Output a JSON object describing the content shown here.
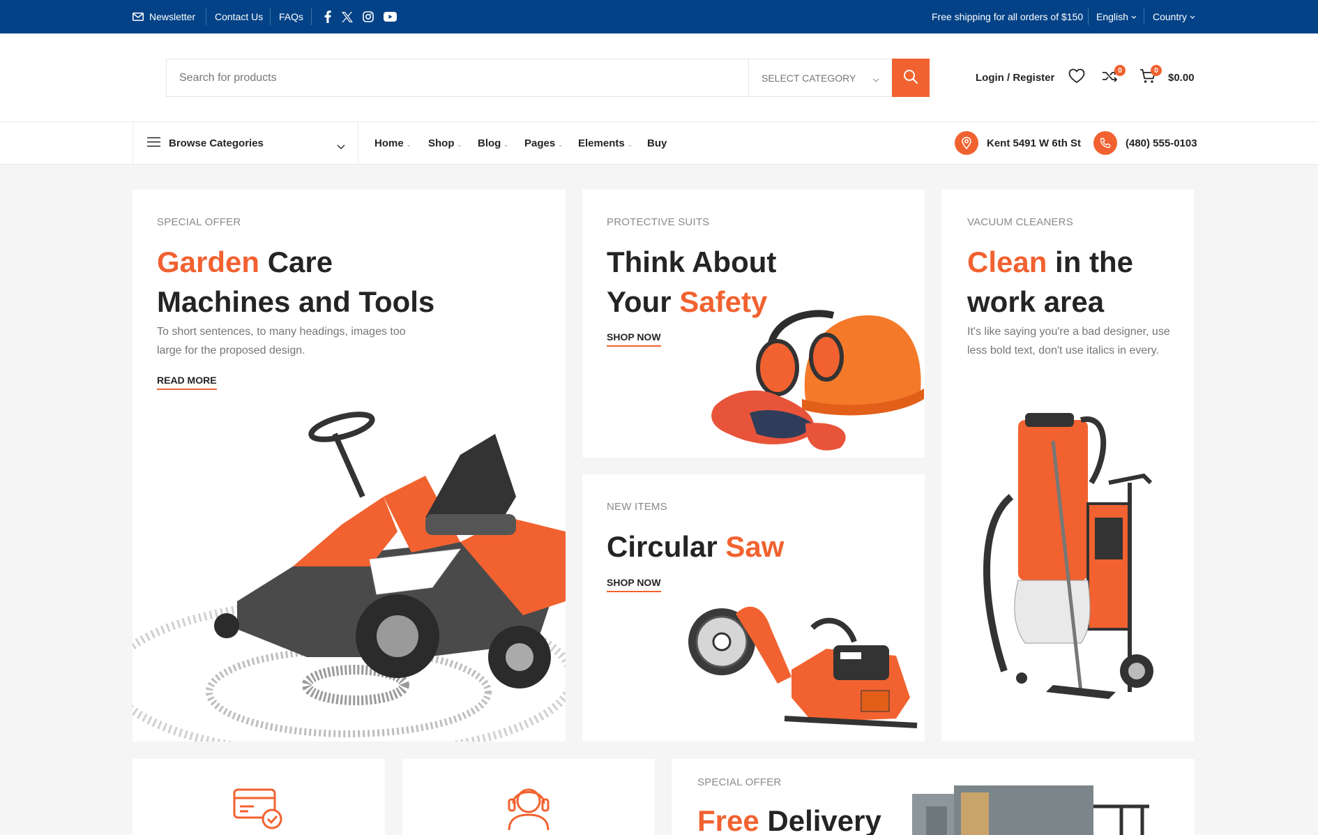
{
  "topbar": {
    "newsletter": "Newsletter",
    "contact_us": "Contact Us",
    "faqs": "FAQs",
    "shipping": "Free shipping for all orders of $150",
    "language": "English",
    "country": "Country",
    "social_icons": [
      "facebook-icon",
      "x-twitter-icon",
      "instagram-icon",
      "youtube-icon"
    ]
  },
  "header": {
    "search_placeholder": "Search for products",
    "category_select": "SELECT CATEGORY",
    "login": "Login / Register",
    "compare_count": "0",
    "cart_count": "0",
    "cart_total": "$0.00"
  },
  "nav": {
    "browse": "Browse Categories",
    "items": [
      "Home",
      "Shop",
      "Blog",
      "Pages",
      "Elements",
      "Buy"
    ],
    "address": "Kent 5491 W 6th St",
    "phone": "(480) 555-0103"
  },
  "cards": {
    "garden": {
      "eyebrow": "SPECIAL OFFER",
      "title_hl": "Garden",
      "title_rest": "Care",
      "title_line2": "Machines and Tools",
      "desc_line1": "To short sentences, to many headings, images too",
      "desc_line2": "large for the proposed design.",
      "cta": "READ MORE"
    },
    "safety": {
      "eyebrow": "PROTECTIVE SUITS",
      "title_line1": "Think About",
      "title_pre": "Your",
      "title_hl": "Safety",
      "cta": "SHOP NOW"
    },
    "vacuum": {
      "eyebrow": "VACUUM CLEANERS",
      "title_hl": "Clean",
      "title_rest": "in the",
      "title_line2": "work area",
      "desc_line1": "It's like saying you're a bad designer, use",
      "desc_line2": "less bold text, don't use italics in every.",
      "cta": ""
    },
    "saw": {
      "eyebrow": "NEW ITEMS",
      "title_pre": "Circular",
      "title_hl": "Saw",
      "cta": "SHOP NOW"
    },
    "delivery": {
      "eyebrow": "SPECIAL OFFER",
      "title_hl": "Free",
      "title_rest": "Delivery"
    }
  },
  "colors": {
    "topbar_bg": "#034287",
    "accent": "#f16230",
    "text": "#242424",
    "muted": "#767676",
    "page_bg": "#f5f5f5"
  }
}
